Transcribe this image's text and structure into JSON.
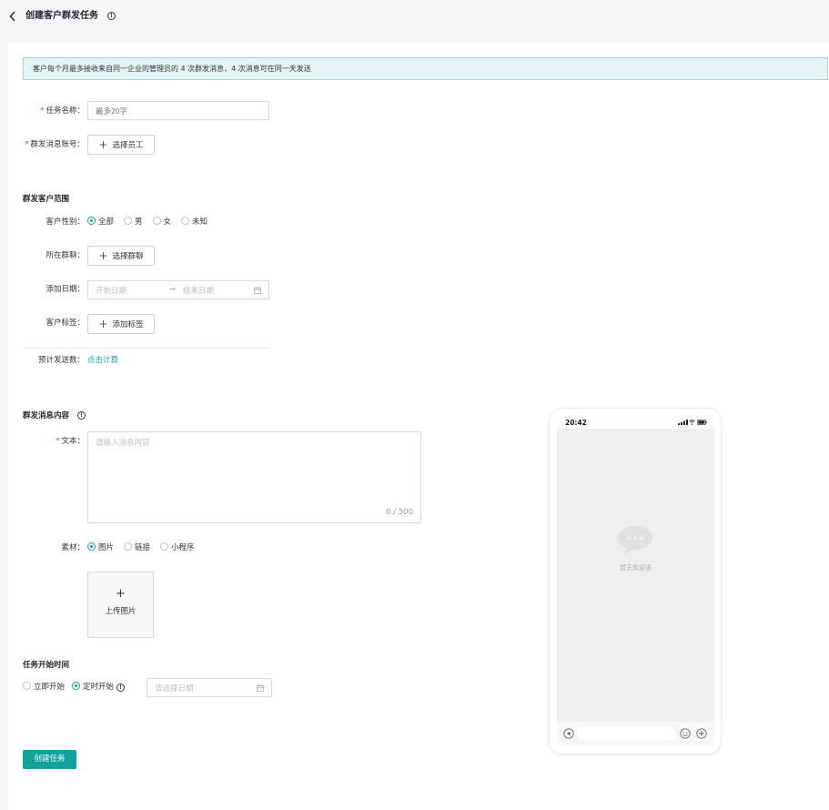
{
  "header": {
    "title": "创建客户群发任务",
    "title_info": "!"
  },
  "notice": "客户每个月最多接收来自同一企业的管理员的 4 次群发消息，4 次消息可在同一天发送",
  "form": {
    "task_name_label": "任务名称：",
    "task_name_placeholder": "最多20字",
    "account_label": "群发消息账号：",
    "select_staff_button": "选择员工",
    "required_mark": "*"
  },
  "scope": {
    "title": "群发客户范围",
    "gender_label": "客户性别：",
    "gender_options": [
      "全部",
      "男",
      "女",
      "未知"
    ],
    "gender_selected": "全部",
    "group_label": "所在群聊：",
    "select_group_button": "选择群聊",
    "date_label": "添加日期：",
    "start_placeholder": "开始日期",
    "date_separator": "→",
    "end_placeholder": "结束日期",
    "tag_label": "客户标签：",
    "add_tag_button": "添加标签",
    "estimate_label": "预计发送数：",
    "estimate_link": "点击计算"
  },
  "content": {
    "title": "群发消息内容",
    "title_info": "!",
    "text_label": "文本：",
    "text_placeholder": "请输入消息内容",
    "counter": "0 / 500",
    "material_label": "素材：",
    "material_options": [
      "图片",
      "链接",
      "小程序"
    ],
    "material_selected": "图片",
    "upload_plus": "+",
    "upload_label": "上传图片"
  },
  "schedule": {
    "title": "任务开始时间",
    "options": [
      "立即开始",
      "定时开始"
    ],
    "selected": "定时开始",
    "timed_info": "!",
    "date_placeholder": "请选择日期"
  },
  "submit_button": "创建任务",
  "preview": {
    "time": "20:42",
    "empty_text": "暂无欢迎语"
  },
  "colors": {
    "accent": "#11a39a",
    "notice_bg": "#e4f4f2",
    "required": "#e23c3c"
  }
}
